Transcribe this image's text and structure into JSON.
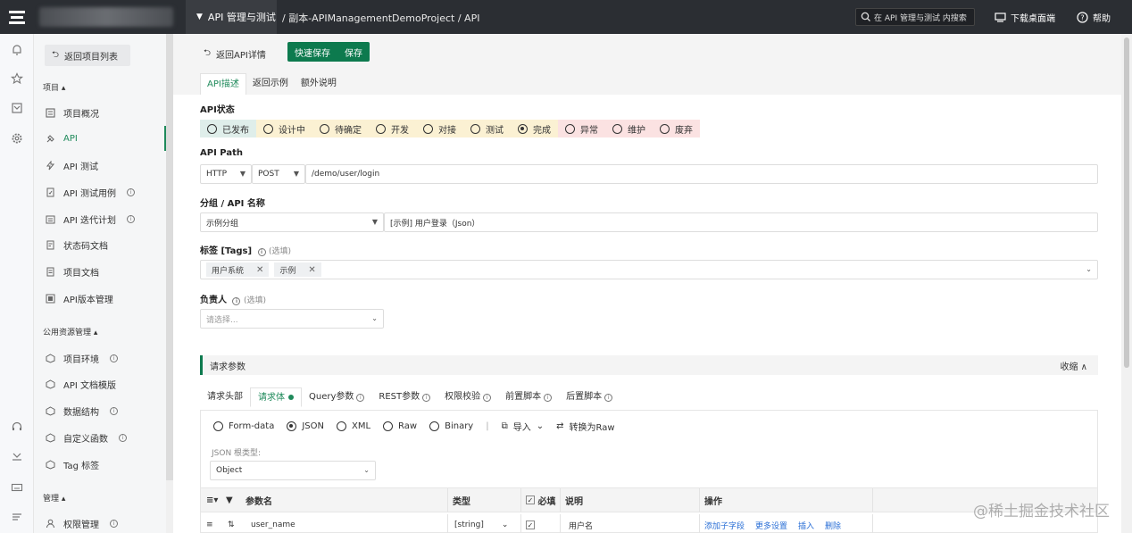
{
  "topbar": {
    "project_menu": "API 管理与测试",
    "breadcrumb": "/ 副本-APIManagementDemoProject / API",
    "search_placeholder": "在 API 管理与测试 内搜索",
    "download": "下载桌面端",
    "help": "帮助"
  },
  "sidebar": {
    "back": "返回项目列表",
    "section_project": "项目",
    "items": [
      {
        "label": "项目概况",
        "icon": "overview-icon"
      },
      {
        "label": "API",
        "icon": "api-icon"
      },
      {
        "label": "API 测试",
        "icon": "api-test-icon"
      },
      {
        "label": "API 测试用例",
        "icon": "test-case-icon"
      },
      {
        "label": "API 迭代计划",
        "icon": "iteration-icon"
      },
      {
        "label": "状态码文档",
        "icon": "status-doc-icon"
      },
      {
        "label": "项目文档",
        "icon": "project-doc-icon"
      },
      {
        "label": "API版本管理",
        "icon": "version-icon"
      }
    ],
    "section_common": "公用资源管理",
    "common_items": [
      {
        "label": "项目环境",
        "icon": "env-icon"
      },
      {
        "label": "API 文档模版",
        "icon": "template-icon"
      },
      {
        "label": "数据结构",
        "icon": "data-structure-icon"
      },
      {
        "label": "自定义函数",
        "icon": "function-icon"
      },
      {
        "label": "Tag 标签",
        "icon": "tag-icon"
      }
    ],
    "section_manage": "管理",
    "manage_items": [
      {
        "label": "权限管理",
        "icon": "permission-icon"
      }
    ]
  },
  "main": {
    "back_api": "返回API详情",
    "quick_save": "快速保存",
    "save": "保存",
    "tabs": [
      "API描述",
      "返回示例",
      "额外说明"
    ],
    "status_label": "API状态",
    "statuses": [
      {
        "label": "已发布",
        "bg": "#dfeeea"
      },
      {
        "label": "设计中",
        "bg": "#fbf1d3"
      },
      {
        "label": "待确定",
        "bg": "#fbf1d3"
      },
      {
        "label": "开发",
        "bg": "#fbf1d3"
      },
      {
        "label": "对接",
        "bg": "#fbf1d3"
      },
      {
        "label": "测试",
        "bg": "#fbf1d3"
      },
      {
        "label": "完成",
        "bg": "#fbf1d3",
        "checked": true
      },
      {
        "label": "异常",
        "bg": "#fbe2e2"
      },
      {
        "label": "维护",
        "bg": "#fbe2e2"
      },
      {
        "label": "废弃",
        "bg": "#fbe2e2"
      }
    ],
    "path_label": "API Path",
    "protocol": "HTTP",
    "method": "POST",
    "path": "/demo/user/login",
    "group_label": "分组 / API 名称",
    "group": "示例分组",
    "api_name": "[示例] 用户登录（Json）",
    "tags_label": "标签 [Tags]",
    "tags_optional": "(选填)",
    "tags": [
      "用户系统",
      "示例"
    ],
    "owner_label": "负责人",
    "owner_optional": "(选填)",
    "owner_placeholder": "请选择...",
    "req_params": "请求参数",
    "collapse": "收缩",
    "sub_tabs": [
      "请求头部",
      "请求体",
      "Query参数",
      "REST参数",
      "权限校验",
      "前置脚本",
      "后置脚本"
    ],
    "formats": [
      "Form-data",
      "JSON",
      "XML",
      "Raw",
      "Binary"
    ],
    "selected_format": "JSON",
    "import": "导入",
    "convert": "转换为Raw",
    "json_root_label": "JSON 根类型:",
    "json_root": "Object",
    "table_headers": [
      "参数名",
      "类型",
      "必填",
      "说明",
      "操作"
    ],
    "row": {
      "name": "user_name",
      "type": "[string]",
      "desc": "用户名",
      "actions": [
        "添加子字段",
        "更多设置",
        "插入",
        "删除"
      ]
    }
  },
  "watermark": "@稀土掘金技术社区"
}
